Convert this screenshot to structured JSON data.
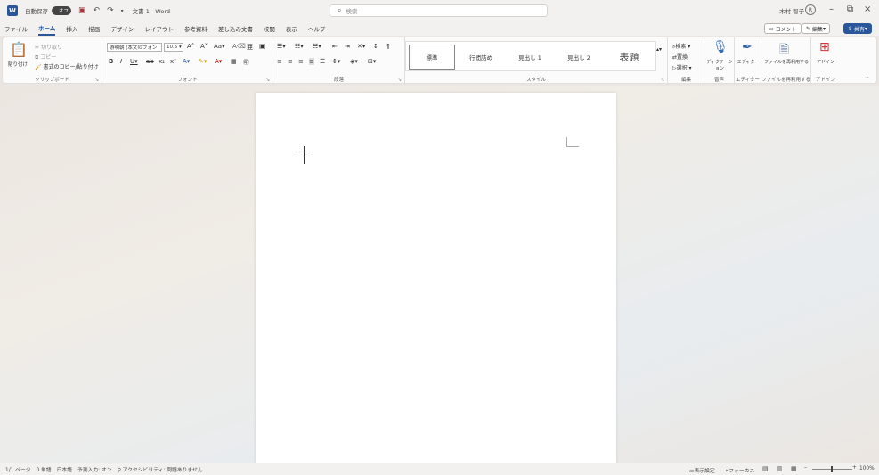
{
  "titlebar": {
    "logo": "W",
    "autosave_label": "自動保存",
    "autosave_state": "オフ",
    "doc_title": "文書 1 - Word",
    "search_placeholder": "検索",
    "user_name": "木村 智子",
    "avatar": "R"
  },
  "menu": {
    "tabs": [
      "ファイル",
      "ホーム",
      "挿入",
      "描画",
      "デザイン",
      "レイアウト",
      "参考資料",
      "差し込み文書",
      "校閲",
      "表示",
      "ヘルプ"
    ],
    "comment_label": "コメント",
    "editing_label": "編集",
    "share_label": "共有"
  },
  "ribbon": {
    "clipboard": {
      "paste": "貼り付け",
      "cut": "切り取り",
      "copy": "コピー",
      "format_painter": "書式のコピー/貼り付け",
      "label": "クリップボード"
    },
    "font": {
      "font_name": "游明朝 (本文のフォン",
      "font_size": "10.5",
      "label": "フォント"
    },
    "paragraph": {
      "label": "段落"
    },
    "styles": {
      "items": [
        "標準",
        "行間詰め",
        "見出し 1",
        "見出し 2",
        "表題"
      ],
      "label": "スタイル"
    },
    "editing": {
      "find": "検索",
      "replace": "置換",
      "select": "選択",
      "label": "編集"
    },
    "voice": {
      "dictate": "ディクテーション",
      "label": "音声"
    },
    "editor": {
      "name": "エディター",
      "label": "エディター"
    },
    "reuse": {
      "name": "ファイルを再利用する",
      "label": "ファイルを再利用する"
    },
    "addins": {
      "name": "アドイン",
      "label": "アドイン"
    }
  },
  "status": {
    "page": "1/1 ページ",
    "words": "0 単語",
    "language": "日本語",
    "ime": "予測入力: オン",
    "accessibility": "アクセシビリティ: 問題ありません",
    "display_settings": "表示設定",
    "focus": "フォーカス",
    "zoom": "100%"
  }
}
